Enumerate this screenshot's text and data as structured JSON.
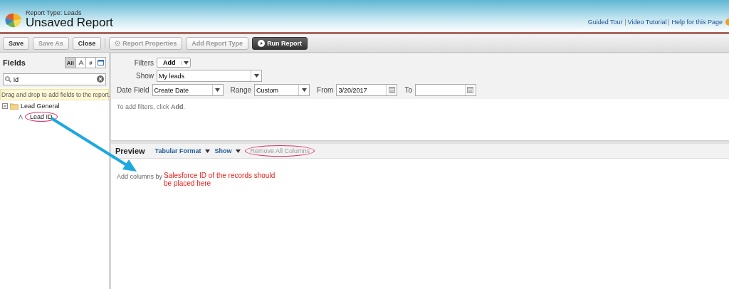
{
  "header": {
    "report_type": "Report Type: Leads",
    "title": "Unsaved Report",
    "links": [
      "Guided Tour",
      "Video Tutorial",
      "Help for this Page"
    ]
  },
  "toolbar": {
    "buttons": [
      {
        "label": "Save",
        "kind": "normal",
        "disabled": false
      },
      {
        "label": "Save As",
        "kind": "normal",
        "disabled": true
      },
      {
        "label": "Close",
        "kind": "normal",
        "disabled": false
      },
      {
        "label": "Report Properties",
        "kind": "gear",
        "disabled": true
      },
      {
        "label": "Add Report Type",
        "kind": "normal",
        "disabled": true
      },
      {
        "label": "Run Report",
        "kind": "run",
        "disabled": false
      }
    ]
  },
  "fields_panel": {
    "title": "Fields",
    "type_filters": [
      {
        "kind": "text",
        "label": "All",
        "selected": true
      },
      {
        "kind": "text-type",
        "selected": false
      },
      {
        "kind": "text",
        "label": "#",
        "selected": false
      },
      {
        "kind": "date-type",
        "selected": false
      }
    ],
    "search": {
      "value": "id"
    },
    "hint": "Drag and drop to add fields to the report.",
    "tree": [
      {
        "label": "Lead General",
        "expanded": true,
        "children": [
          {
            "label": "Lead ID"
          }
        ]
      }
    ]
  },
  "filters": {
    "filters_label": "Filters",
    "add_button": "Add",
    "show": {
      "label": "Show",
      "value": "My leads"
    },
    "date_field": {
      "label": "Date Field",
      "value": "Create Date"
    },
    "range": {
      "label": "Range",
      "value": "Custom"
    },
    "from": {
      "label": "From",
      "value": "3/20/2017"
    },
    "to": {
      "label": "To"
    },
    "empty_text": "To add filters, click **Add**."
  },
  "preview": {
    "title": "Preview",
    "menus": [
      {
        "label": "Tabular Format"
      },
      {
        "label": "Show"
      }
    ],
    "remove_all": {
      "label": "Remove All Columns",
      "disabled": true
    },
    "hint": "Add columns by"
  },
  "annotation": {
    "text": "Salesforce ID of the records should be placed here"
  }
}
